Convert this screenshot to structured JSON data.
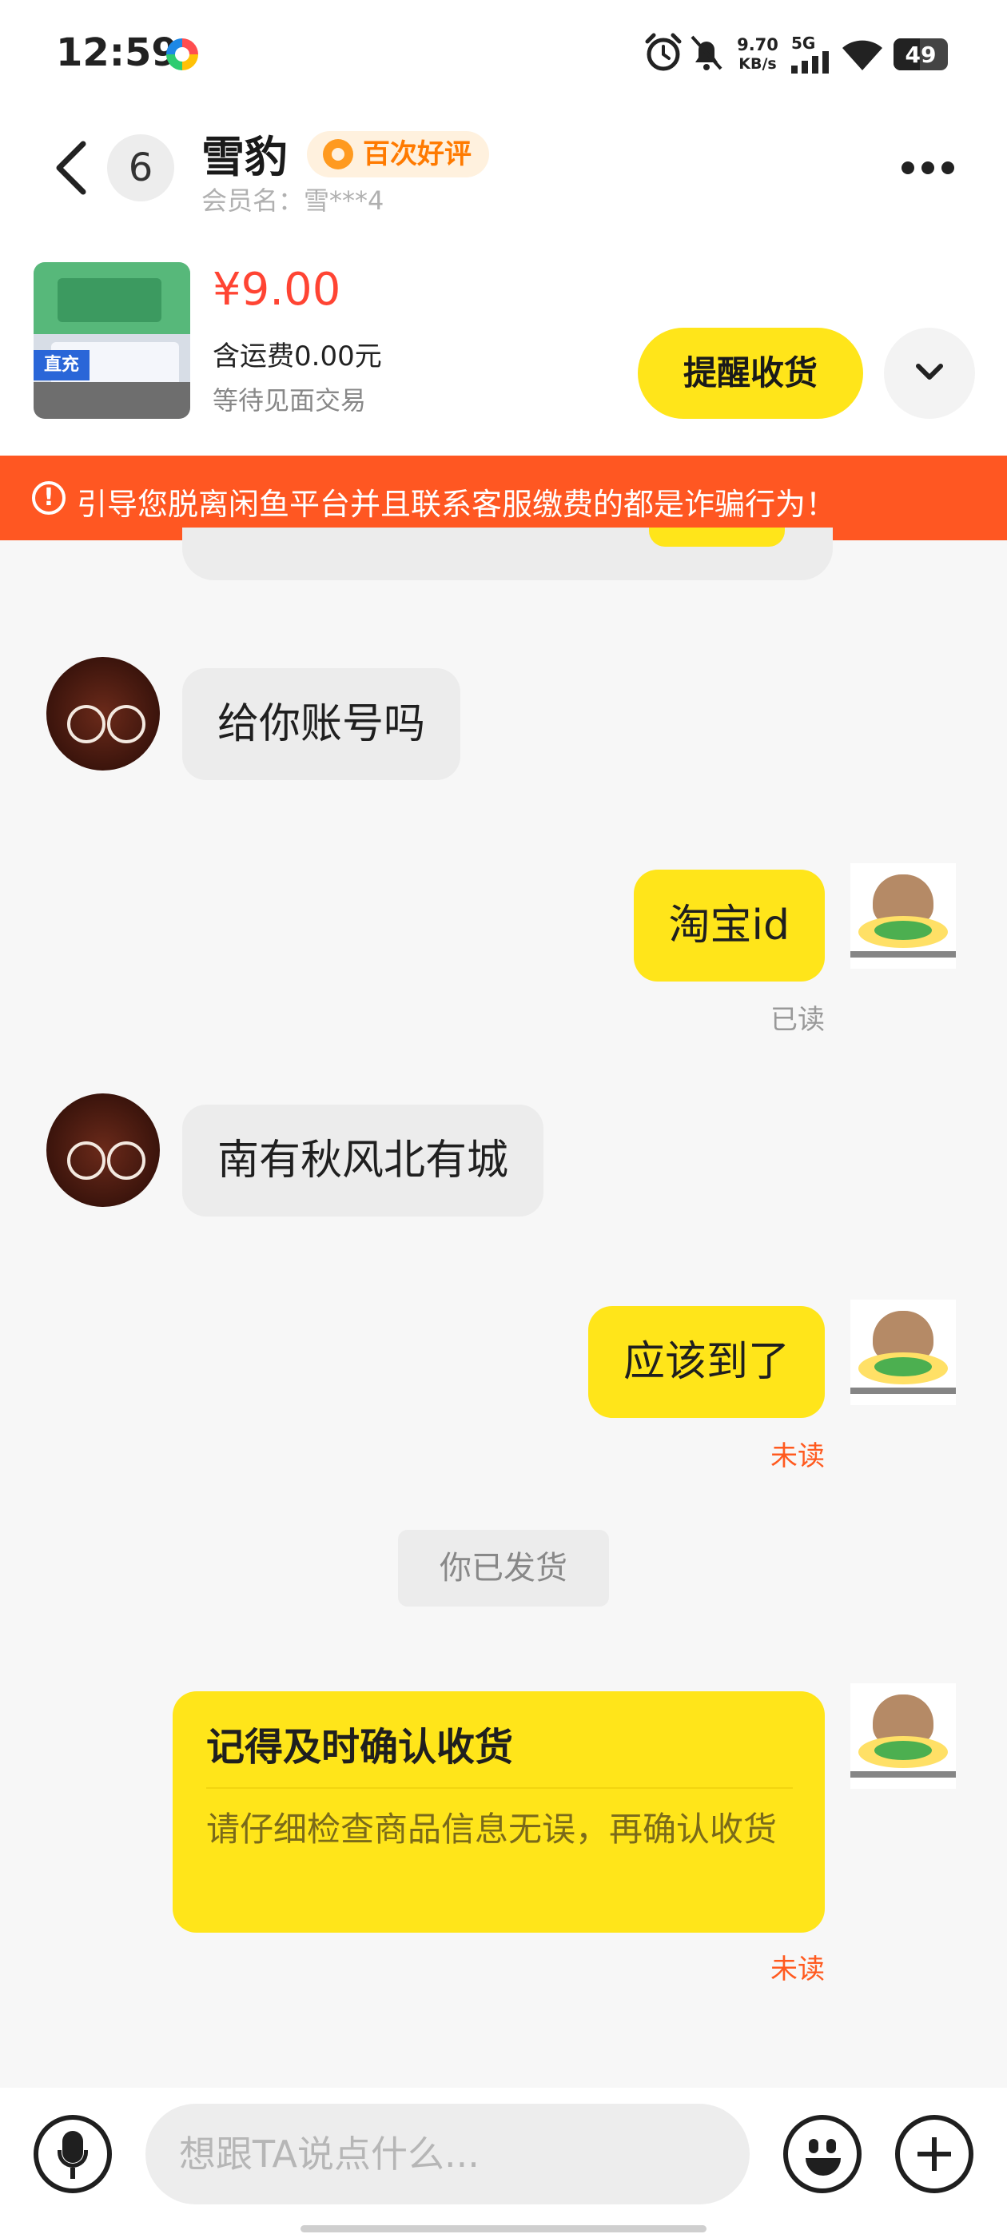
{
  "status_bar": {
    "time": "12:59",
    "net_speed": "9.70",
    "net_unit": "KB/s",
    "network_gen": "5G",
    "battery_level": "49",
    "icons": [
      "app-logo-icon",
      "alarm-icon",
      "mute-bell-icon",
      "signal-icon",
      "wifi-icon",
      "battery-icon"
    ]
  },
  "header": {
    "unread_count": "6",
    "contact_name": "雪豹",
    "badge_label": "百次好评",
    "member_name": "会员名：雪***4"
  },
  "product": {
    "thumb_tag": "直充",
    "price": "¥9.00",
    "shipping": "含运费0.00元",
    "status": "等待见面交易",
    "action_label": "提醒收货"
  },
  "warning": {
    "text": "引导您脱离闲鱼平台并且联系客服缴费的都是诈骗行为！"
  },
  "messages": [
    {
      "side": "left",
      "text": "给你账号吗"
    },
    {
      "side": "right",
      "text": "淘宝id",
      "status": "已读"
    },
    {
      "side": "left",
      "text": "南有秋风北有城"
    },
    {
      "side": "right",
      "text": "应该到了",
      "status": "未读"
    }
  ],
  "system_message": "你已发货",
  "confirm_card": {
    "title": "记得及时确认收货",
    "body": "请仔细检查商品信息无误，再确认收货",
    "status": "未读"
  },
  "input": {
    "placeholder": "想跟TA说点什么..."
  },
  "colors": {
    "accent_yellow": "#ffe51a",
    "warning_orange": "#ff5722",
    "price_red": "#ff4433",
    "unread_red": "#ff5a1f"
  }
}
